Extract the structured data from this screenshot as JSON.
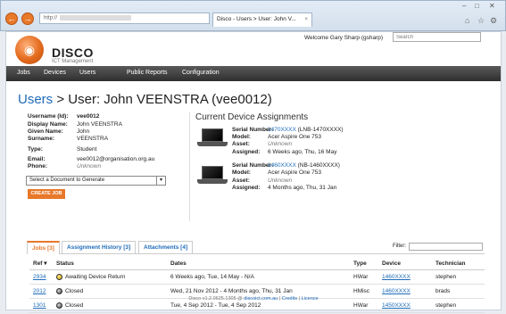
{
  "browser": {
    "address_text": "http://",
    "tab_title": "Disco - Users > User: John V...",
    "tab_close": "×",
    "window_min": "‒",
    "window_max": "□",
    "window_close": "✕",
    "back_icon": "←",
    "forward_icon": "→",
    "home_icon": "⌂",
    "favorites_icon": "☆",
    "settings_icon": "⚙"
  },
  "header": {
    "brand": "DISCO",
    "brand_sub": "ICT Management",
    "welcome": "Welcome Gary Sharp (gsharp)",
    "search_placeholder": "Search"
  },
  "nav": {
    "items": [
      "Jobs",
      "Devices",
      "Users",
      "Public Reports",
      "Configuration"
    ]
  },
  "breadcrumb": {
    "users_link": "Users",
    "separator": ">",
    "title": "User: John VEENSTRA (vee0012)"
  },
  "user": {
    "username_label": "Username (Id):",
    "username": "vee0012",
    "display_label": "Display Name:",
    "display": "John VEENSTRA",
    "given_label": "Given Name:",
    "given": "John",
    "surname_label": "Surname:",
    "surname": "VEENSTRA",
    "type_label": "Type:",
    "type": "Student",
    "email_label": "Email:",
    "email": "vee0012@organisation.org.au",
    "phone_label": "Phone:",
    "phone": "Unknown"
  },
  "document_select": {
    "value": "Select a Document to Generate",
    "arrow": "▾"
  },
  "create_job_label": "CREATE JOB",
  "assignments": {
    "title": "Current Device Assignments",
    "devices": [
      {
        "serial_label": "Serial Number:",
        "serial": "1470XXXX",
        "serial_extra": "(LNB-1470XXXX)",
        "model_label": "Model:",
        "model": "Acer Aspire One 753",
        "asset_label": "Asset:",
        "asset": "Unknown",
        "assigned_label": "Assigned:",
        "assigned": "6 Weeks ago, Thu, 16 May"
      },
      {
        "serial_label": "Serial Number:",
        "serial": "1460XXXX",
        "serial_extra": "(NB-1460XXXX)",
        "model_label": "Model:",
        "model": "Acer Aspire One 753",
        "asset_label": "Asset:",
        "asset": "Unknown",
        "assigned_label": "Assigned:",
        "assigned": "4 Months ago, Thu, 31 Jan"
      }
    ]
  },
  "tabs": {
    "jobs": "Jobs [3]",
    "history": "Assignment History [3]",
    "attachments": "Attachments [4]",
    "filter_label": "Filter:"
  },
  "table": {
    "headers": [
      "Ref",
      "Status",
      "Dates",
      "Type",
      "Device",
      "Technician"
    ],
    "sort_icon": "▾",
    "rows": [
      {
        "ref": "2934",
        "status": "Awaiting Device Return",
        "status_color": "#d4b000",
        "dates": "6 Weeks ago, Tue, 14 May - N/A",
        "type": "HWar",
        "device": "1460XXXX",
        "tech": "stephen"
      },
      {
        "ref": "2012",
        "status": "Closed",
        "status_color": "#555555",
        "dates": "Wed, 21 Nov 2012 - 4 Months ago, Thu, 31 Jan",
        "type": "HMisc",
        "device": "1460XXXX",
        "tech": "brads"
      },
      {
        "ref": "1301",
        "status": "Closed",
        "status_color": "#555555",
        "dates": "Tue, 4 Sep 2012 - Tue, 4 Sep 2012",
        "type": "HWar",
        "device": "1450XXXX",
        "tech": "stephen"
      }
    ]
  },
  "footer": {
    "version": "Disco v1.2.0625.1305 @",
    "site": "discoict.com.au",
    "sep": "|",
    "credits": "Credits",
    "licence": "Licence"
  }
}
